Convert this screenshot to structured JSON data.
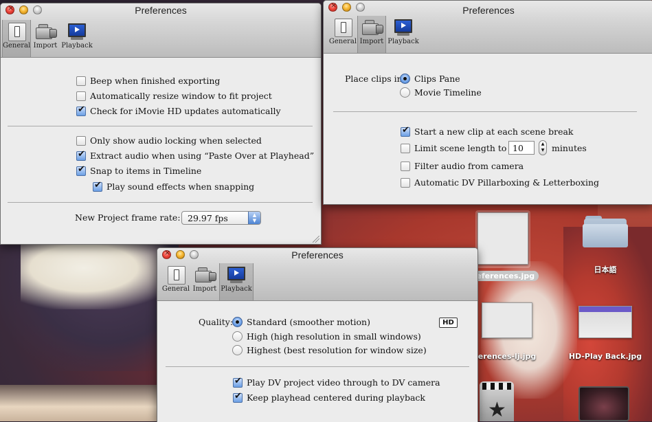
{
  "desktop": {
    "icons": [
      {
        "label": "references.jpg",
        "selected": true
      },
      {
        "label": "日本語"
      },
      {
        "label": "erences-lj.jpg"
      },
      {
        "label": "HD-Play Back.jpg"
      }
    ]
  },
  "windows": {
    "general": {
      "title": "Preferences",
      "tabs": [
        {
          "label": "General"
        },
        {
          "label": "Import"
        },
        {
          "label": "Playback"
        }
      ],
      "selected_tab": "General",
      "checkboxes": [
        {
          "label": "Beep when finished exporting",
          "checked": false
        },
        {
          "label": "Automatically resize window to fit project",
          "checked": false
        },
        {
          "label": "Check for iMovie HD updates automatically",
          "checked": true
        },
        {
          "label": "Only show audio locking when selected",
          "checked": false
        },
        {
          "label": "Extract audio when using “Paste Over at Playhead”",
          "checked": true
        },
        {
          "label": "Snap to items in Timeline",
          "checked": true
        },
        {
          "label": "Play sound effects when snapping",
          "checked": true
        }
      ],
      "frame_rate_label": "New Project frame rate:",
      "frame_rate_value": "29.97 fps"
    },
    "import": {
      "title": "Preferences",
      "tabs": [
        {
          "label": "General"
        },
        {
          "label": "Import"
        },
        {
          "label": "Playback"
        }
      ],
      "selected_tab": "Import",
      "place_clips_label": "Place clips in:",
      "radios": [
        {
          "label": "Clips Pane",
          "selected": true
        },
        {
          "label": "Movie Timeline",
          "selected": false
        }
      ],
      "checkboxes": [
        {
          "label": "Start a new clip at each scene break",
          "checked": true
        },
        {
          "label": "Limit scene length to",
          "checked": false
        },
        {
          "label": "Filter audio from camera",
          "checked": false
        },
        {
          "label": "Automatic DV Pillarboxing & Letterboxing",
          "checked": false
        }
      ],
      "scene_length_value": "10",
      "scene_length_unit": "minutes"
    },
    "playback": {
      "title": "Preferences",
      "tabs": [
        {
          "label": "General"
        },
        {
          "label": "Import"
        },
        {
          "label": "Playback"
        }
      ],
      "selected_tab": "Playback",
      "quality_label": "Quality:",
      "hd_badge": "HD",
      "radios": [
        {
          "label": "Standard (smoother motion)",
          "selected": true
        },
        {
          "label": "High (high resolution in small windows)",
          "selected": false
        },
        {
          "label": "Highest (best resolution for window size)",
          "selected": false
        }
      ],
      "checkboxes": [
        {
          "label": "Play DV project video through to DV camera",
          "checked": true
        },
        {
          "label": "Keep playhead centered during playback",
          "checked": true
        }
      ]
    }
  }
}
